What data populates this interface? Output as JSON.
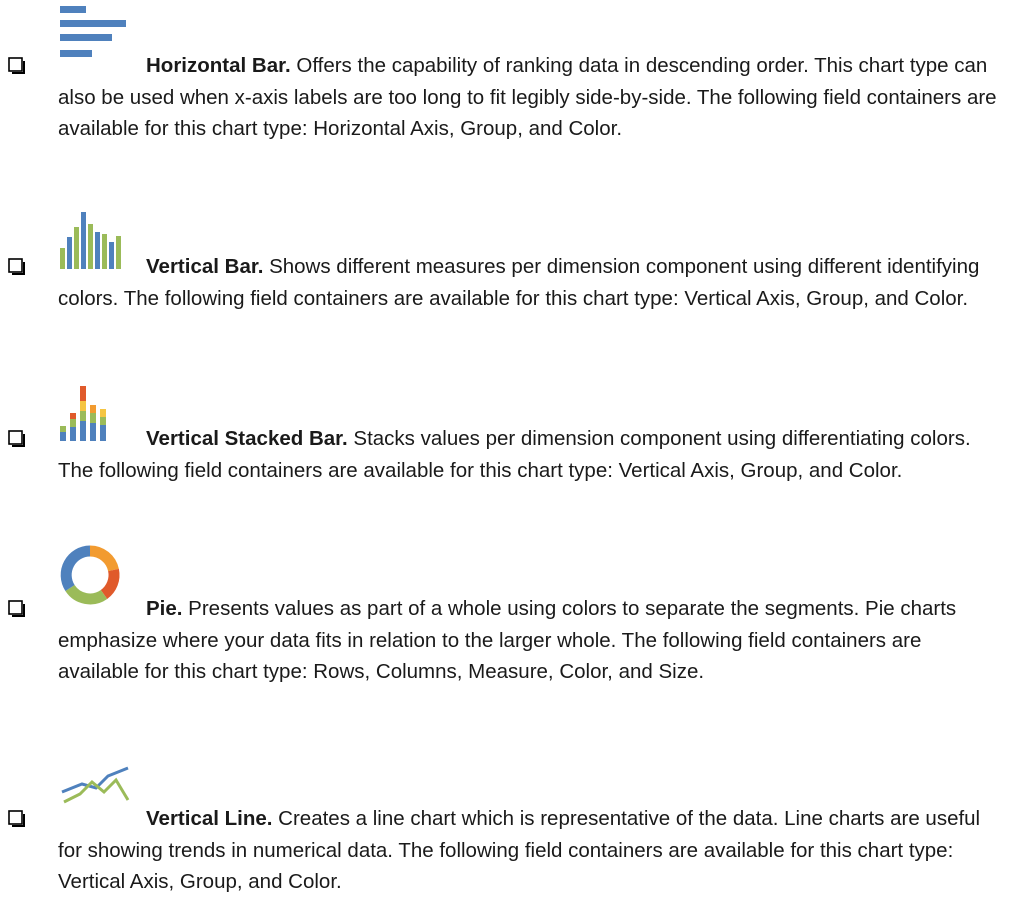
{
  "items": [
    {
      "term": "Horizontal Bar.",
      "description": " Offers the capability of ranking data in descending order. This chart type can also be used when x-axis labels are too long to fit legibly side-by-side. The following field containers are available for this chart type: Horizontal Axis, Group, and Color.",
      "icon": "horizontal-bar-chart-icon"
    },
    {
      "term": "Vertical Bar.",
      "description": " Shows different measures per dimension component using different identifying colors. The following field containers are available for this chart type: Vertical Axis, Group, and Color.",
      "icon": "vertical-bar-chart-icon"
    },
    {
      "term": "Vertical Stacked Bar.",
      "description": " Stacks values per dimension component using differentiating colors. The following field containers are available for this chart type: Vertical Axis, Group, and Color.",
      "icon": "vertical-stacked-bar-chart-icon"
    },
    {
      "term": "Pie.",
      "description": " Presents values as part of a whole using colors to separate the segments. Pie charts emphasize where your data fits in relation to the larger whole. The following field containers are available for this chart type: Rows, Columns, Measure, Color, and Size.",
      "icon": "pie-chart-icon"
    },
    {
      "term": "Vertical Line.",
      "description": " Creates a line chart which is representative of the data. Line charts are useful for showing trends in numerical data. The following field containers are available for this chart type: Vertical Axis, Group, and Color.",
      "icon": "line-chart-icon"
    }
  ],
  "colors": {
    "blue": "#4f81bd",
    "green": "#9bbb59",
    "red": "#e05a2b",
    "orange": "#f29b30",
    "yellow": "#f5c542",
    "text": "#1a1a1a"
  }
}
